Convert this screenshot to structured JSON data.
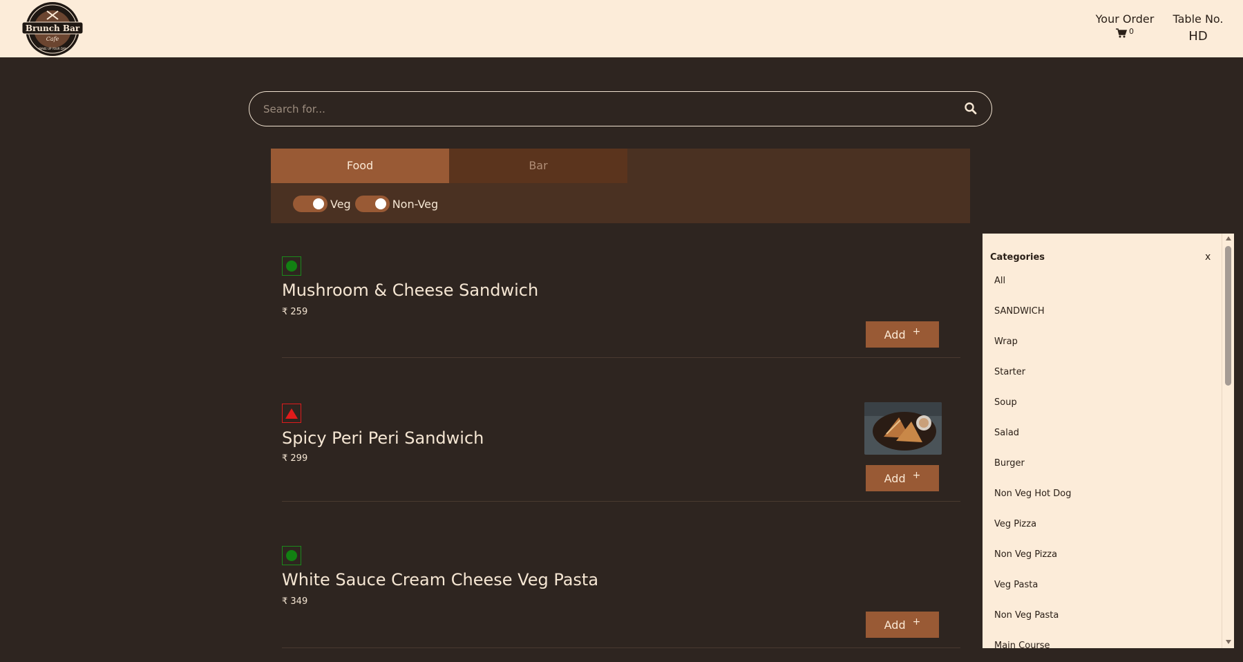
{
  "header": {
    "logo": {
      "name": "Brunch Bar",
      "sub": "Cafe",
      "tagline": "WAKE UP YOUR DAY"
    },
    "order": {
      "title": "Your Order",
      "cart_icon": "cart-icon",
      "count": "0"
    },
    "table": {
      "title": "Table No.",
      "value": "HD"
    }
  },
  "search": {
    "placeholder": "Search for...",
    "icon": "search-icon"
  },
  "tabs": [
    {
      "label": "Food",
      "active": true
    },
    {
      "label": "Bar",
      "active": false
    }
  ],
  "filters": [
    {
      "label": "Veg",
      "on": true
    },
    {
      "label": "Non-Veg",
      "on": true
    }
  ],
  "items": [
    {
      "name": "Mushroom & Cheese Sandwich",
      "price": "₹ 259",
      "type": "veg",
      "add_label": "Add",
      "has_image": false
    },
    {
      "name": "Spicy Peri Peri Sandwich",
      "price": "₹ 299",
      "type": "non-veg",
      "add_label": "Add",
      "has_image": true
    },
    {
      "name": "White Sauce Cream Cheese Veg Pasta",
      "price": "₹ 349",
      "type": "veg",
      "add_label": "Add",
      "has_image": false
    }
  ],
  "categories": {
    "title": "Categories",
    "close": "x",
    "items": [
      "All",
      "SANDWICH",
      "Wrap",
      "Starter",
      "Soup",
      "Salad",
      "Burger",
      "Non Veg Hot Dog",
      "Veg Pizza",
      "Non Veg Pizza",
      "Veg Pasta",
      "Non Veg Pasta",
      "Main Course"
    ]
  },
  "colors": {
    "background": "#2e2520",
    "header": "#fcecd9",
    "accent": "#995a35",
    "panel": "#4a3122",
    "veg": "#128012",
    "nonveg": "#e01b1b"
  }
}
